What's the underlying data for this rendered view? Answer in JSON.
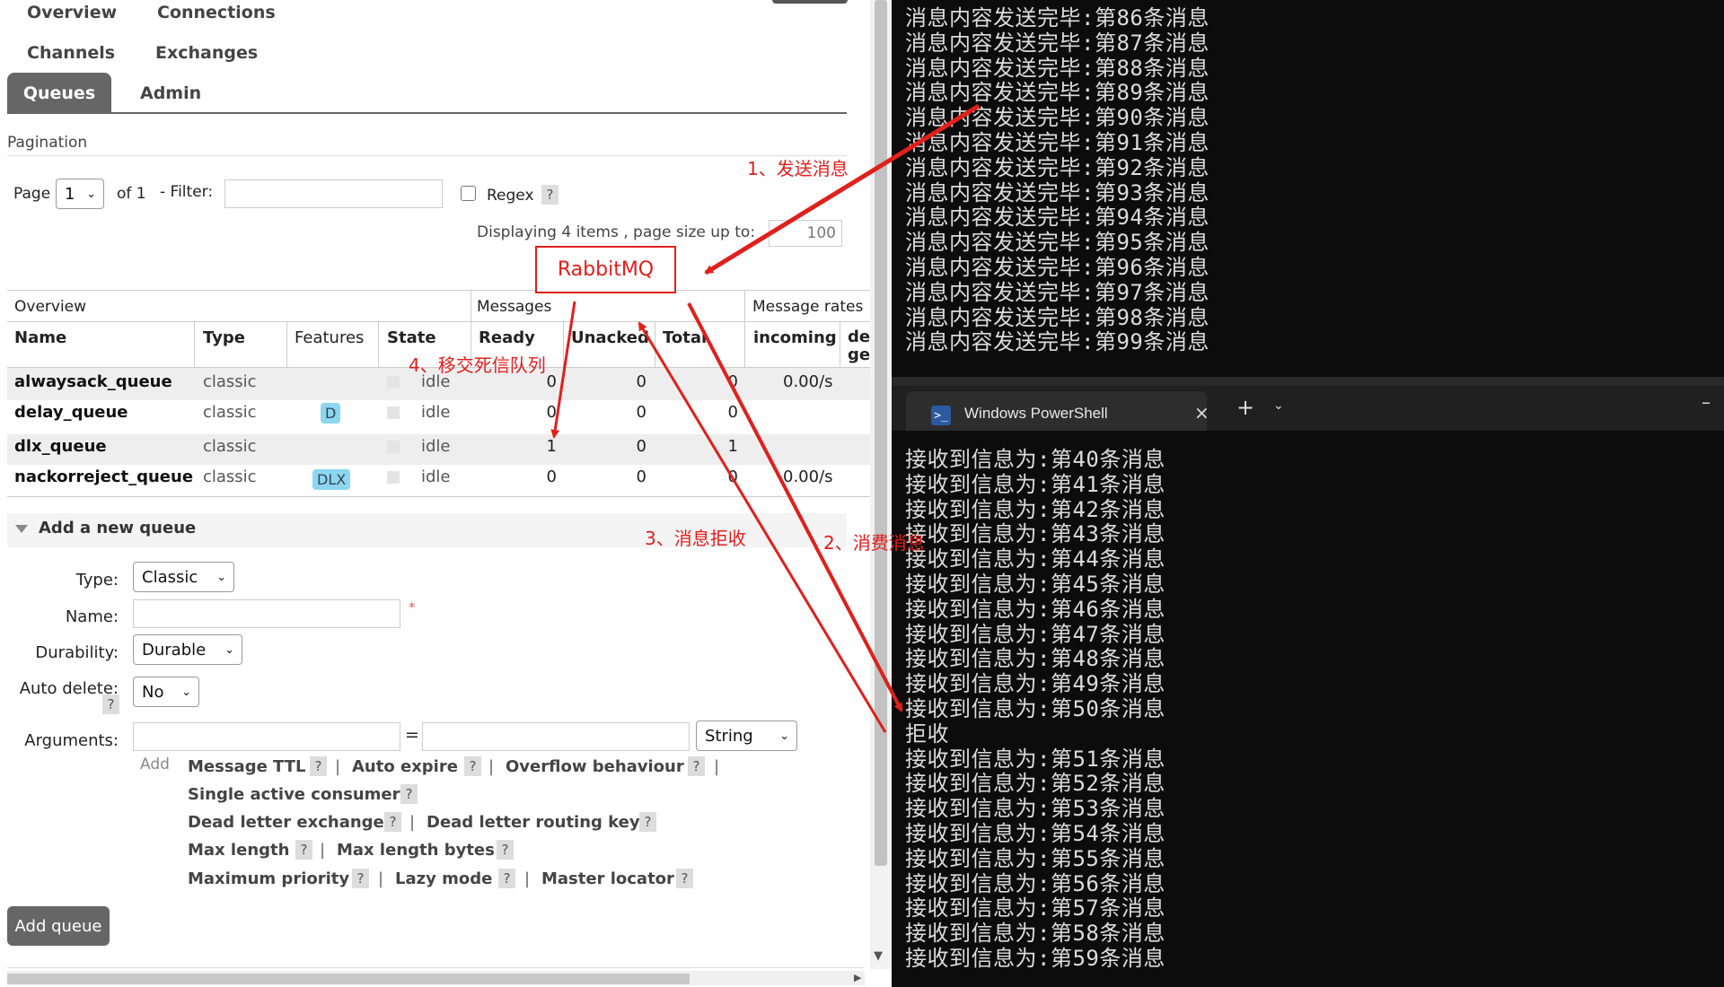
{
  "nav": {
    "row1": [
      "Overview",
      "Connections"
    ],
    "row2": [
      "Channels",
      "Exchanges"
    ],
    "active_tab": "Queues",
    "row3_other": "Admin"
  },
  "pagination": {
    "title": "Pagination",
    "page_label": "Page",
    "page_value": "1",
    "of_label": "of 1",
    "filter_label": "- Filter:",
    "filter_value": "",
    "regex_label": "Regex",
    "help": "?",
    "displaying": "Displaying 4 items , page size up to:",
    "page_size": "100"
  },
  "table": {
    "group_overview": "Overview",
    "group_messages": "Messages",
    "group_rates": "Message rates",
    "headers": {
      "name": "Name",
      "type": "Type",
      "features": "Features",
      "state": "State",
      "ready": "Ready",
      "unacked": "Unacked",
      "total": "Total",
      "incoming": "incoming",
      "deliver": "de ge"
    },
    "rows": [
      {
        "name": "alwaysack_queue",
        "type": "classic",
        "feature": "",
        "state": "idle",
        "ready": "0",
        "unacked": "0",
        "total": "0",
        "incoming": "0.00/s"
      },
      {
        "name": "delay_queue",
        "type": "classic",
        "feature": "D",
        "state": "idle",
        "ready": "0",
        "unacked": "0",
        "total": "0",
        "incoming": ""
      },
      {
        "name": "dlx_queue",
        "type": "classic",
        "feature": "",
        "state": "idle",
        "ready": "1",
        "unacked": "0",
        "total": "1",
        "incoming": ""
      },
      {
        "name": "nackorreject_queue",
        "type": "classic",
        "feature": "DLX",
        "state": "idle",
        "ready": "0",
        "unacked": "0",
        "total": "0",
        "incoming": "0.00/s"
      }
    ]
  },
  "add_queue": {
    "section_title": "Add a new queue",
    "type_label": "Type:",
    "type_value": "Classic",
    "name_label": "Name:",
    "name_value": "",
    "required_mark": "*",
    "durability_label": "Durability:",
    "durability_value": "Durable",
    "autodelete_label": "Auto delete:",
    "autodelete_value": "No",
    "arguments_label": "Arguments:",
    "arg_type_value": "String",
    "equals": "=",
    "add_label": "Add",
    "arg_links": {
      "message_ttl": "Message TTL",
      "auto_expire": "Auto expire",
      "overflow": "Overflow behaviour",
      "single_active": "Single active consumer",
      "dl_exchange": "Dead letter exchange",
      "dl_routing_key": "Dead letter routing key",
      "max_length": "Max length",
      "max_length_bytes": "Max length bytes",
      "max_priority": "Maximum priority",
      "lazy_mode": "Lazy mode",
      "master_locator": "Master locator"
    },
    "separator": "|",
    "submit_label": "Add queue"
  },
  "terminal_top": {
    "lines": [
      "消息内容发送完毕:第86条消息",
      "消息内容发送完毕:第87条消息",
      "消息内容发送完毕:第88条消息",
      "消息内容发送完毕:第89条消息",
      "消息内容发送完毕:第90条消息",
      "消息内容发送完毕:第91条消息",
      "消息内容发送完毕:第92条消息",
      "消息内容发送完毕:第93条消息",
      "消息内容发送完毕:第94条消息",
      "消息内容发送完毕:第95条消息",
      "消息内容发送完毕:第96条消息",
      "消息内容发送完毕:第97条消息",
      "消息内容发送完毕:第98条消息",
      "消息内容发送完毕:第99条消息"
    ]
  },
  "terminal_bottom": {
    "tab_title": "Windows PowerShell",
    "close_icon": "×",
    "new_tab": "+",
    "lines": [
      "接收到信息为:第40条消息",
      "接收到信息为:第41条消息",
      "接收到信息为:第42条消息",
      "接收到信息为:第43条消息",
      "接收到信息为:第44条消息",
      "接收到信息为:第45条消息",
      "接收到信息为:第46条消息",
      "接收到信息为:第47条消息",
      "接收到信息为:第48条消息",
      "接收到信息为:第49条消息",
      "接收到信息为:第50条消息",
      "拒收",
      "接收到信息为:第51条消息",
      "接收到信息为:第52条消息",
      "接收到信息为:第53条消息",
      "接收到信息为:第54条消息",
      "接收到信息为:第55条消息",
      "接收到信息为:第56条消息",
      "接收到信息为:第57条消息",
      "接收到信息为:第58条消息",
      "接收到信息为:第59条消息"
    ]
  },
  "annotations": {
    "box": "RabbitMQ",
    "step1": "1、发送消息",
    "step2": "2、消费消息",
    "step3": "3、消息拒收",
    "step4": "4、移交死信队列",
    "color": "#e0201c"
  }
}
